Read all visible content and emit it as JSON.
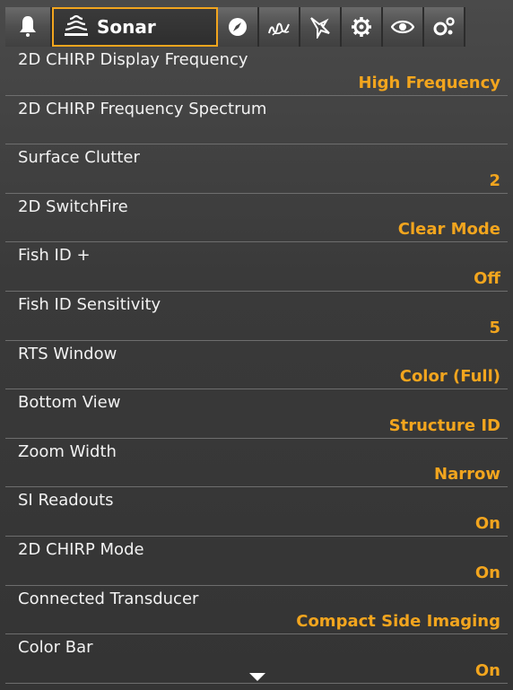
{
  "tabs": [
    {
      "name": "alarms",
      "icon": "bell-icon"
    },
    {
      "name": "sonar",
      "icon": "sonar-icon",
      "label": "Sonar",
      "active": true
    },
    {
      "name": "navigation",
      "icon": "compass-icon"
    },
    {
      "name": "chart",
      "icon": "chart-contour-icon"
    },
    {
      "name": "fish",
      "icon": "fish-icon"
    },
    {
      "name": "setup",
      "icon": "gear-icon"
    },
    {
      "name": "views",
      "icon": "eye-icon"
    },
    {
      "name": "accessories",
      "icon": "accessories-icon"
    }
  ],
  "menu": {
    "items": [
      {
        "label": "2D CHIRP Display Frequency",
        "value": "High Frequency"
      },
      {
        "label": "2D CHIRP Frequency Spectrum",
        "value": ""
      },
      {
        "label": "Surface Clutter",
        "value": "2"
      },
      {
        "label": "2D SwitchFire",
        "value": "Clear Mode"
      },
      {
        "label": "Fish ID +",
        "value": "Off"
      },
      {
        "label": "Fish ID Sensitivity",
        "value": "5"
      },
      {
        "label": "RTS Window",
        "value": "Color (Full)"
      },
      {
        "label": "Bottom View",
        "value": "Structure ID"
      },
      {
        "label": "Zoom Width",
        "value": "Narrow"
      },
      {
        "label": "SI Readouts",
        "value": "On"
      },
      {
        "label": "2D CHIRP Mode",
        "value": "On"
      },
      {
        "label": "Connected Transducer",
        "value": "Compact Side Imaging"
      },
      {
        "label": "Color Bar",
        "value": "On"
      }
    ]
  },
  "colors": {
    "accent": "#f2a51e",
    "text": "#f2f2f2",
    "background": "#3a3a3a"
  },
  "footer": {
    "icon": "scroll-down-arrow-icon"
  }
}
